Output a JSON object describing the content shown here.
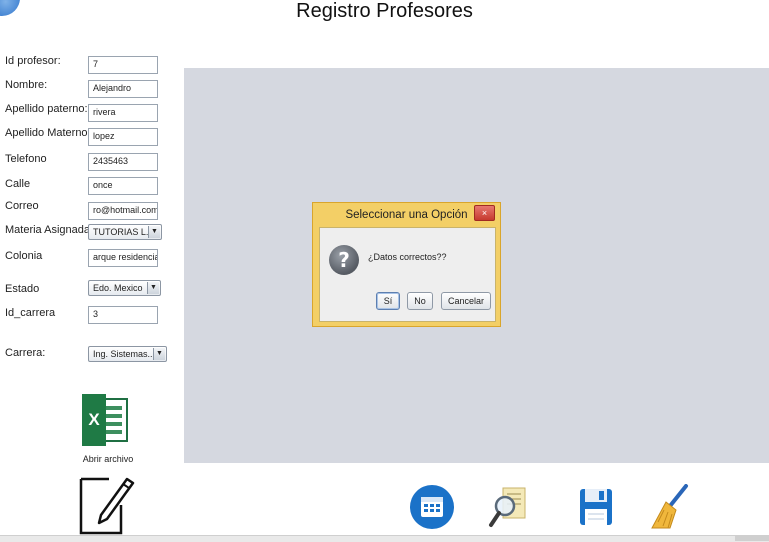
{
  "window": {
    "title": "Registro Profesores"
  },
  "form": {
    "id_profesor": {
      "label": "Id profesor:",
      "value": "7"
    },
    "nombre": {
      "label": "Nombre:",
      "value": "Alejandro"
    },
    "apellido_paterno": {
      "label": "Apellido paterno:",
      "value": "rivera"
    },
    "apellido_materno": {
      "label": "Apellido Materno:",
      "value": "lopez"
    },
    "telefono": {
      "label": "Telefono",
      "value": "2435463"
    },
    "calle": {
      "label": "Calle",
      "value": "once"
    },
    "correo": {
      "label": "Correo",
      "value": "ro@hotmail.com"
    },
    "materia_asignada": {
      "label": "Materia Asignada:",
      "value": "TUTORIAS L."
    },
    "colonia": {
      "label": "Colonia",
      "value": "arque residencial"
    },
    "estado": {
      "label": "Estado",
      "value": "Edo. Mexico"
    },
    "id_carrera": {
      "label": "Id_carrera",
      "value": "3"
    },
    "carrera": {
      "label": "Carrera:",
      "value": "Ing. Sistemas..."
    }
  },
  "excel": {
    "label": "Abrir archivo"
  },
  "dialog": {
    "title": "Seleccionar una Opción",
    "close": "×",
    "message": "¿Datos correctos??",
    "buttons": {
      "yes": "Sí",
      "no": "No",
      "cancel": "Cancelar"
    },
    "question_glyph": "?"
  },
  "icons": {
    "calendar": "calendar-icon",
    "search": "search-document-icon",
    "save": "save-floppy-icon",
    "clear": "broom-icon",
    "edit": "edit-pencil-icon",
    "excel": "excel-icon"
  },
  "colors": {
    "panel": "#d5d8e0",
    "dialog_frame": "#f3cf66",
    "accent_blue": "#1b72c8",
    "excel_green": "#1f7a45"
  }
}
